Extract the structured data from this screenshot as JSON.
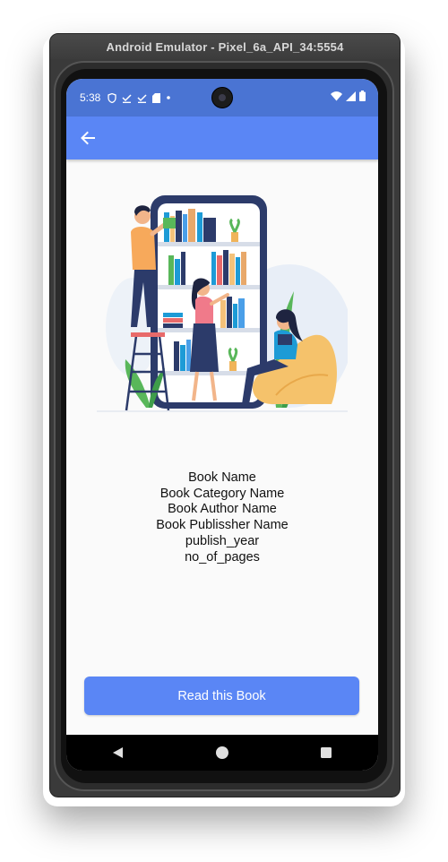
{
  "emulator": {
    "title": "Android Emulator - Pixel_6a_API_34:5554"
  },
  "statusbar": {
    "time": "5:38"
  },
  "appbar": {
    "back_icon": "arrow-back-icon"
  },
  "illustration": {
    "name": "library-readers-illustration"
  },
  "book": {
    "name": "Book Name",
    "category": "Book Category Name",
    "author": "Book Author Name",
    "publisher": "Book Publissher Name",
    "year": "publish_year",
    "pages": "no_of_pages"
  },
  "actions": {
    "read_label": "Read this Book"
  },
  "colors": {
    "statusbar": "#4a74d3",
    "appbar": "#5a86f5",
    "button": "#5a86f5",
    "background": "#fafafa"
  }
}
